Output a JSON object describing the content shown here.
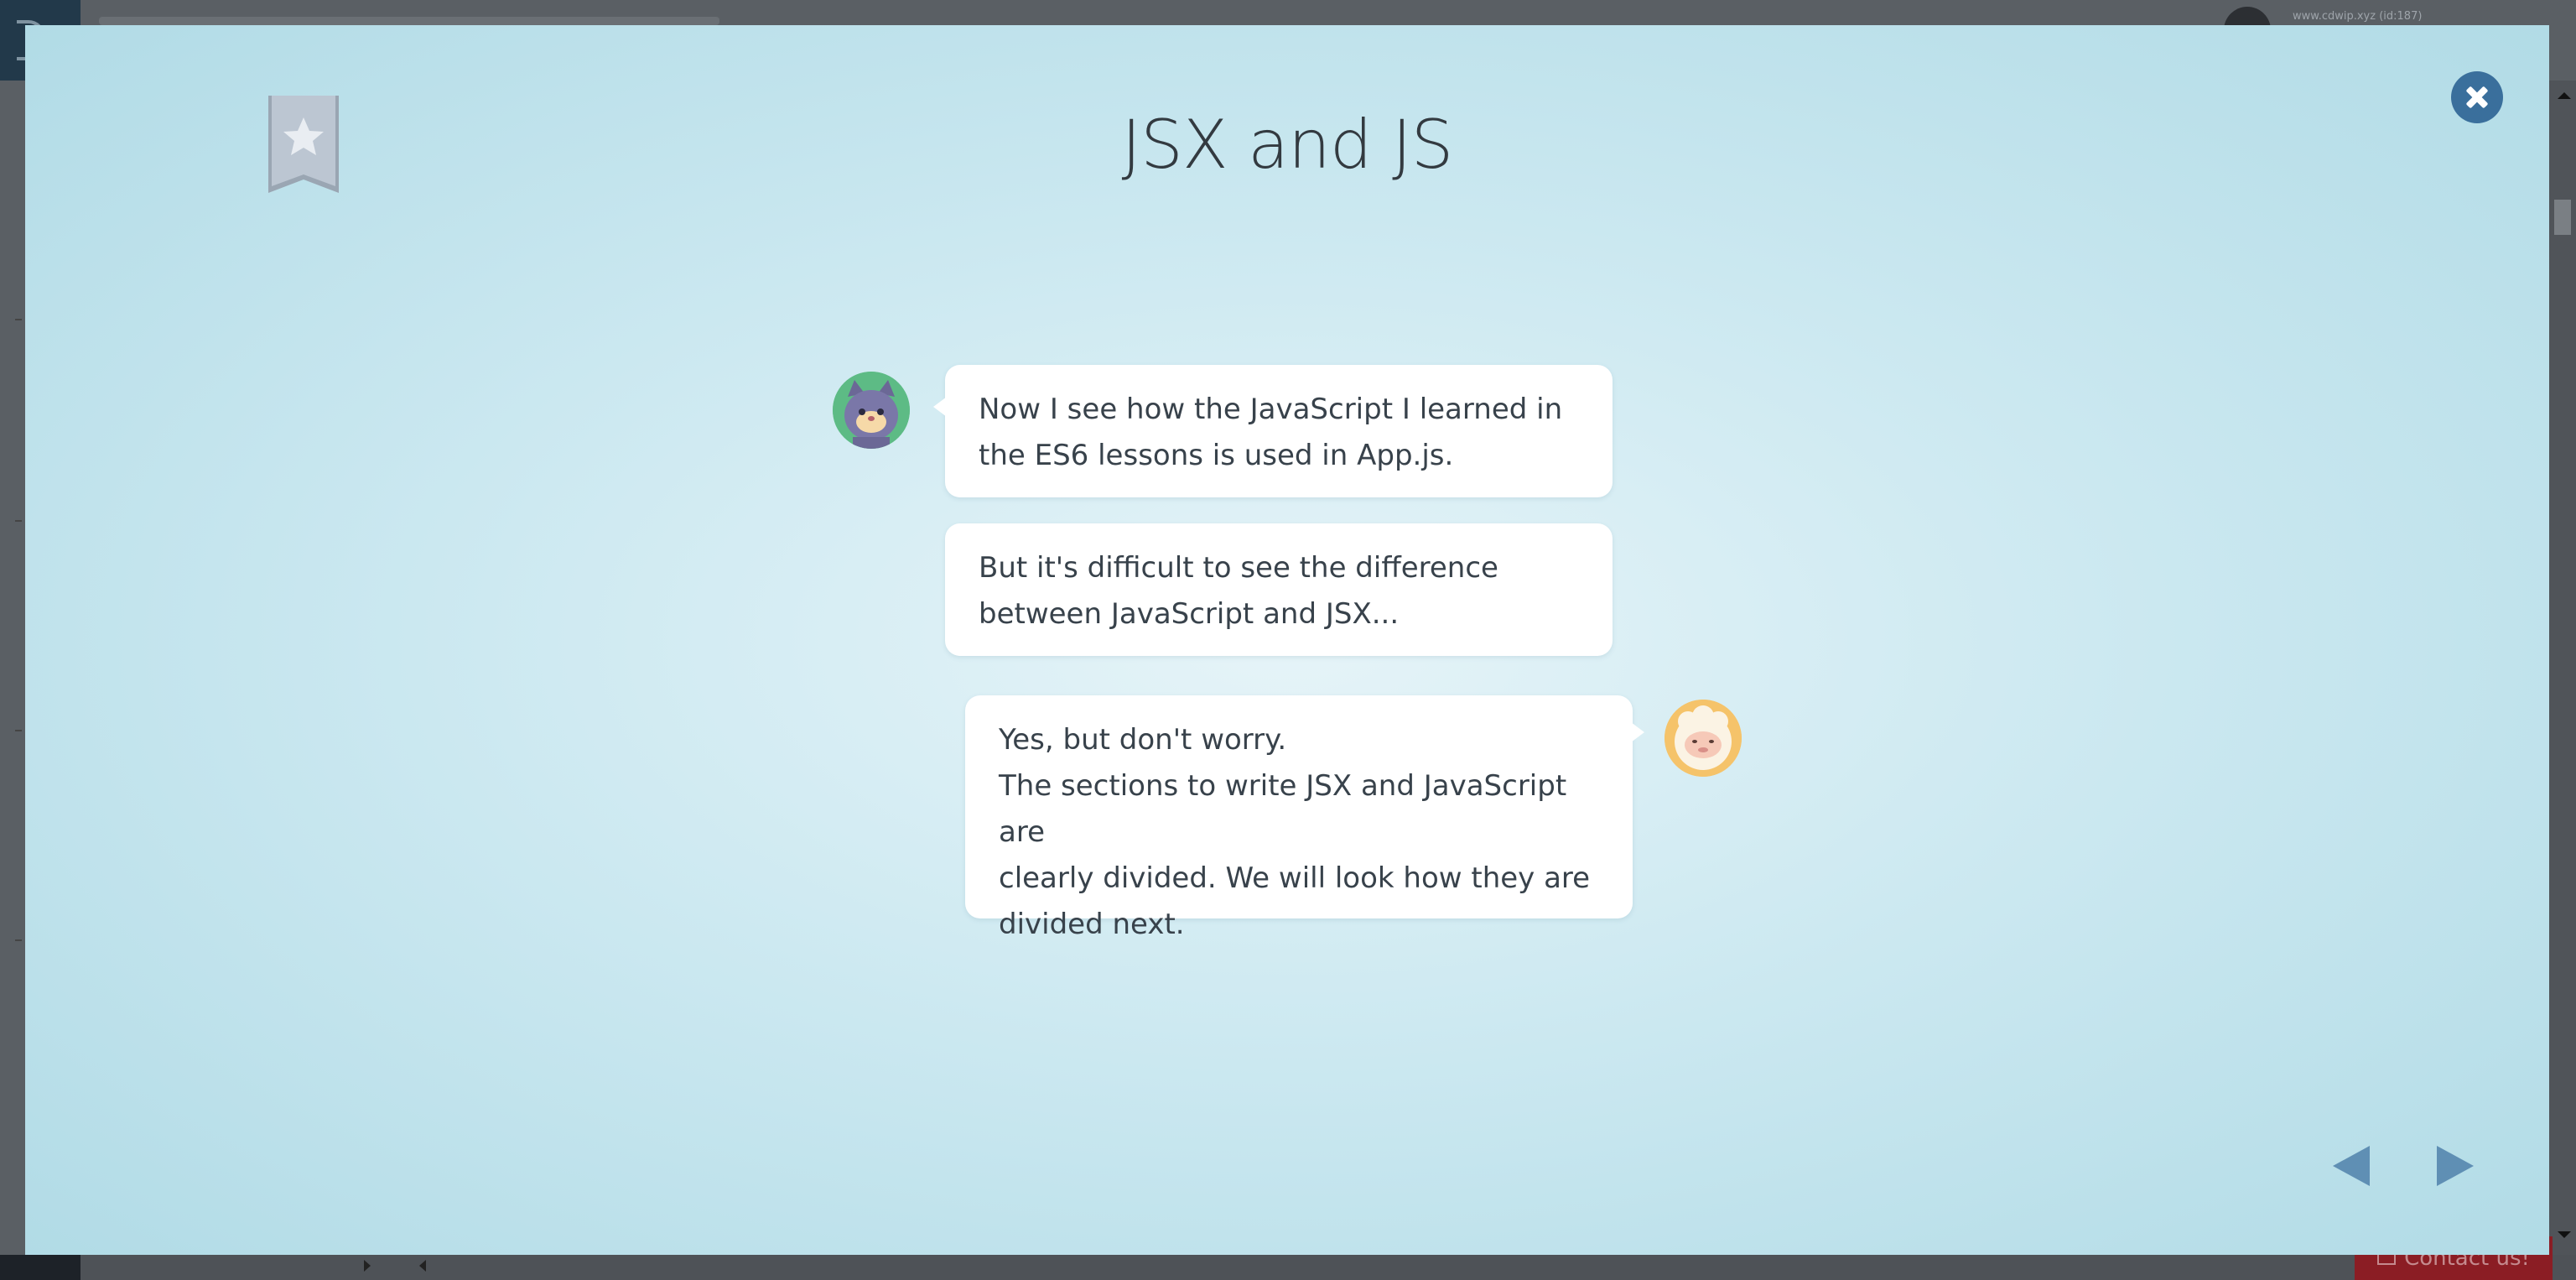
{
  "background_app": {
    "user_label": "www.cdwip.xyz (id:187)",
    "contact_label": "Contact us!"
  },
  "lesson": {
    "title": "JSX and JS"
  },
  "dialogue": [
    {
      "speaker_icon": "cat-avatar-icon",
      "lines": [
        "Now I see how the JavaScript I learned in",
        "the ES6 lessons is used in App.js."
      ]
    },
    {
      "lines": [
        "But it's difficult to see the difference",
        "between JavaScript and JSX..."
      ]
    },
    {
      "speaker_icon": "sheep-avatar-icon",
      "lines": [
        "Yes, but don't worry.",
        "The sections to write JSX and JavaScript are",
        "clearly divided. We will look how they are",
        "divided next."
      ]
    }
  ],
  "controls": {
    "bookmark_icon": "bookmark-star-icon",
    "close_icon": "close-icon",
    "prev_icon": "triangle-left-icon",
    "next_icon": "triangle-right-icon"
  },
  "colors": {
    "modal_bg": "#cde9f1",
    "accent": "#3a6f9c",
    "text": "#333a40",
    "bookmark": "#b9c3d0"
  }
}
